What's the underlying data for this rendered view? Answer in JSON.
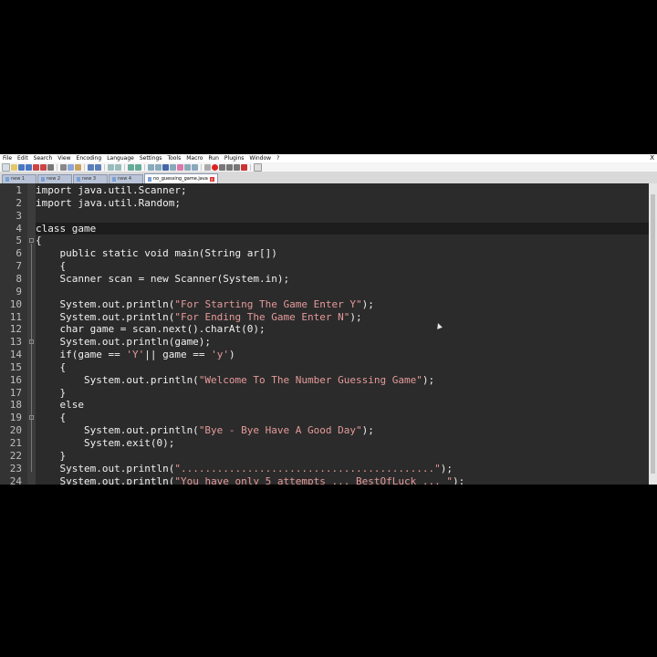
{
  "menu": [
    "File",
    "Edit",
    "Search",
    "View",
    "Encoding",
    "Language",
    "Settings",
    "Tools",
    "Macro",
    "Run",
    "Plugins",
    "Window",
    "?"
  ],
  "window_close": "X",
  "tabs": [
    {
      "label": "new 1"
    },
    {
      "label": "new 2"
    },
    {
      "label": "new 3"
    },
    {
      "label": "new 4"
    },
    {
      "label": "no_guessing_game.java",
      "active": true
    }
  ],
  "code_lines": [
    {
      "n": "1",
      "t": "import java.util.Scanner;"
    },
    {
      "n": "2",
      "t": "import java.util.Random;"
    },
    {
      "n": "3",
      "t": ""
    },
    {
      "n": "4",
      "t": "class game"
    },
    {
      "n": "5",
      "t": "{"
    },
    {
      "n": "6",
      "t": "    public static void main(String ar[])"
    },
    {
      "n": "7",
      "t": "    {"
    },
    {
      "n": "8",
      "t": "    Scanner scan = new Scanner(System.in);"
    },
    {
      "n": "9",
      "t": ""
    },
    {
      "n": "10",
      "t": "    System.out.println(\"For Starting The Game Enter Y\");"
    },
    {
      "n": "11",
      "t": "    System.out.println(\"For Ending The Game Enter N\");"
    },
    {
      "n": "12",
      "t": "    char game = scan.next().charAt(0);"
    },
    {
      "n": "13",
      "t": "    System.out.println(game);"
    },
    {
      "n": "14",
      "t": "    if(game == 'Y'|| game == 'y')"
    },
    {
      "n": "15",
      "t": "    {"
    },
    {
      "n": "16",
      "t": "        System.out.println(\"Welcome To The Number Guessing Game\");"
    },
    {
      "n": "17",
      "t": "    }"
    },
    {
      "n": "18",
      "t": "    else"
    },
    {
      "n": "19",
      "t": "    {"
    },
    {
      "n": "20",
      "t": "        System.out.println(\"Bye - Bye Have A Good Day\");"
    },
    {
      "n": "21",
      "t": "        System.exit(0);"
    },
    {
      "n": "22",
      "t": "    }"
    },
    {
      "n": "23",
      "t": "    System.out.println(\"..........................................\");"
    },
    {
      "n": "24",
      "t": "    System.out.println(\"You have only 5 attempts ... BestOfLuck ... \");"
    }
  ],
  "colors": {
    "editor_bg": "#2b2b2b",
    "text": "#f0f0f0",
    "string": "#e59a9a",
    "line_number": "#bfbfbf"
  }
}
